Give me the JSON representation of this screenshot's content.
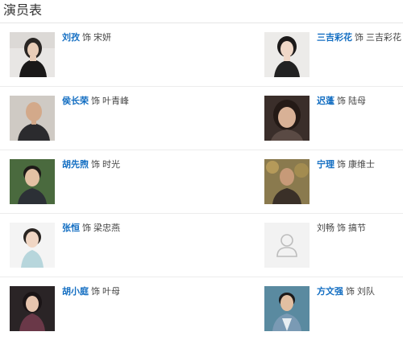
{
  "section": {
    "title": "演员表"
  },
  "cast": [
    {
      "actor": "刘孜",
      "as": "饰",
      "role": "宋妍",
      "linked": true,
      "photo": "actor-photo"
    },
    {
      "actor": "三吉彩花",
      "as": "饰",
      "role": "三吉彩花",
      "linked": true,
      "photo": "actor-photo"
    },
    {
      "actor": "侯长荣",
      "as": "饰",
      "role": "叶青峰",
      "linked": true,
      "photo": "actor-photo"
    },
    {
      "actor": "迟蓬",
      "as": "饰",
      "role": "陆母",
      "linked": true,
      "photo": "actor-photo"
    },
    {
      "actor": "胡先煦",
      "as": "饰",
      "role": "时光",
      "linked": true,
      "photo": "actor-photo"
    },
    {
      "actor": "宁理",
      "as": "饰",
      "role": "康维士",
      "linked": true,
      "photo": "actor-photo"
    },
    {
      "actor": "张恒",
      "as": "饰",
      "role": "梁忠燕",
      "linked": true,
      "photo": "actor-photo"
    },
    {
      "actor": "刘畅",
      "as": "饰",
      "role": "搞节",
      "linked": false,
      "photo": "placeholder-avatar-icon"
    },
    {
      "actor": "胡小庭",
      "as": "饰",
      "role": "叶母",
      "linked": true,
      "photo": "actor-photo"
    },
    {
      "actor": "方文强",
      "as": "饰",
      "role": "刘队",
      "linked": true,
      "photo": "actor-photo"
    }
  ],
  "colors": {
    "link": "#136ec2",
    "text": "#444444",
    "divider": "#ececec",
    "placeholder_bg": "#f2f2f2"
  }
}
